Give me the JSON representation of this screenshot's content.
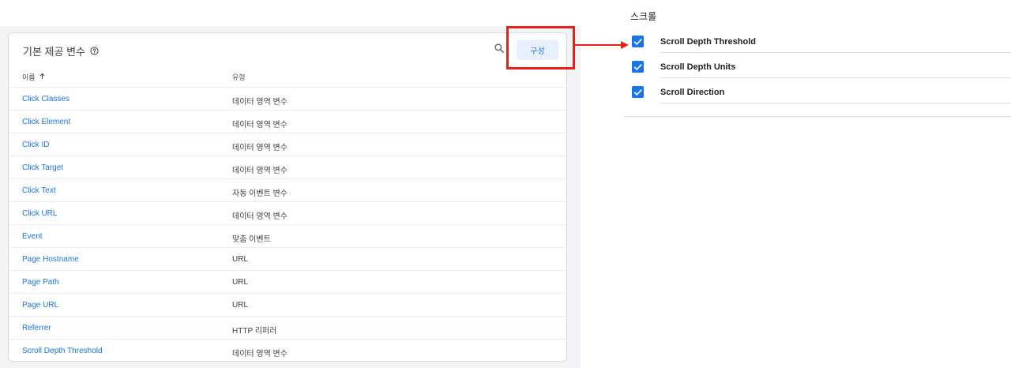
{
  "panel": {
    "title": "기본 제공 변수",
    "config_label": "구성",
    "col_name": "이름",
    "col_type": "유형",
    "rows": [
      {
        "name": "Click Classes",
        "type": "데이터 영역 변수"
      },
      {
        "name": "Click Element",
        "type": "데이터 영역 변수"
      },
      {
        "name": "Click ID",
        "type": "데이터 영역 변수"
      },
      {
        "name": "Click Target",
        "type": "데이터 영역 변수"
      },
      {
        "name": "Click Text",
        "type": "자동 이벤트 변수"
      },
      {
        "name": "Click URL",
        "type": "데이터 영역 변수"
      },
      {
        "name": "Event",
        "type": "맞춤 이벤트"
      },
      {
        "name": "Page Hostname",
        "type": "URL"
      },
      {
        "name": "Page Path",
        "type": "URL"
      },
      {
        "name": "Page URL",
        "type": "URL"
      },
      {
        "name": "Referrer",
        "type": "HTTP 리퍼러"
      },
      {
        "name": "Scroll Depth Threshold",
        "type": "데이터 영역 변수"
      }
    ]
  },
  "scroll": {
    "title": "스크롤",
    "items": [
      {
        "label": "Scroll Depth Threshold",
        "checked": true
      },
      {
        "label": "Scroll Depth Units",
        "checked": true
      },
      {
        "label": "Scroll Direction",
        "checked": true
      }
    ]
  },
  "icons": {
    "help": "help-circle-icon",
    "search": "search-icon",
    "sort": "arrow-up-icon",
    "check": "check-icon"
  },
  "colors": {
    "accent": "#1a73e8",
    "highlight": "#e8201a",
    "button_bg": "#e8f0fe"
  }
}
